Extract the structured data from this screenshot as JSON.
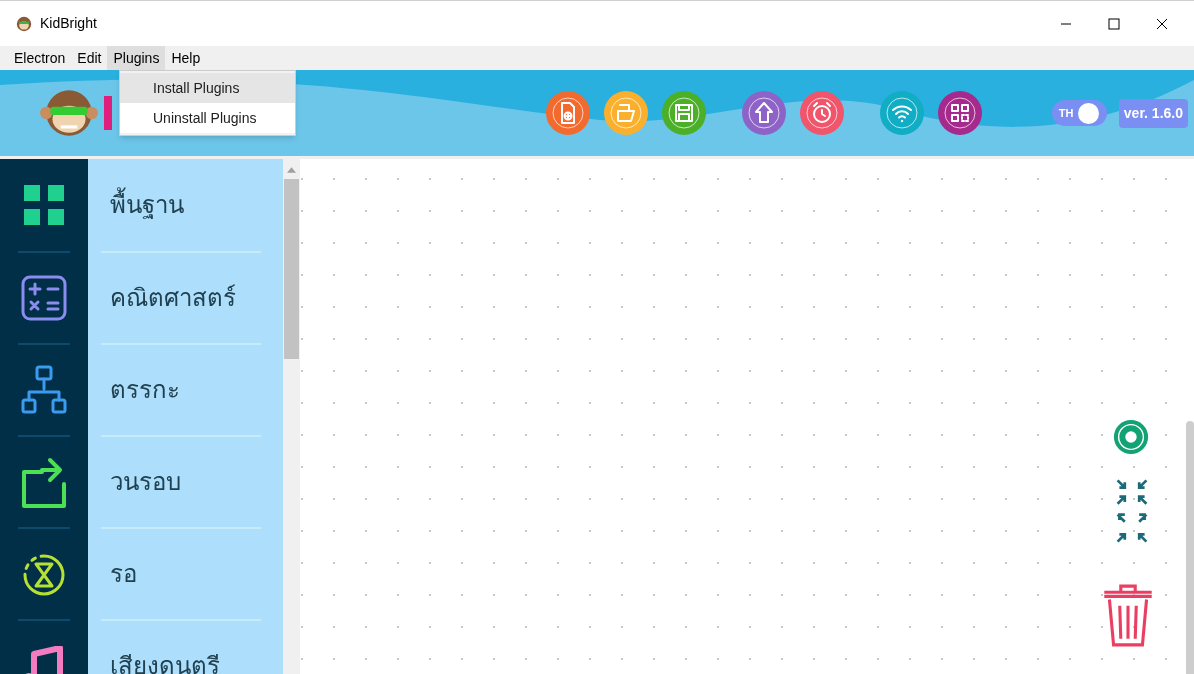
{
  "window": {
    "title": "KidBright"
  },
  "menu": [
    {
      "label": "Electron",
      "selected": false
    },
    {
      "label": "Edit",
      "selected": false
    },
    {
      "label": "Plugins",
      "selected": true
    },
    {
      "label": "Help",
      "selected": false
    }
  ],
  "dropdown": [
    {
      "label": "Install Plugins",
      "selected": true
    },
    {
      "label": "Uninstall Plugins",
      "selected": false
    }
  ],
  "toolbar": [
    {
      "kind": "new",
      "color": "#f26a2d"
    },
    {
      "kind": "open",
      "color": "#fbb02d"
    },
    {
      "kind": "save",
      "color": "#4caf28"
    },
    {
      "kind": "upload",
      "color": "#8e63c7"
    },
    {
      "kind": "alarm",
      "color": "#f0556b"
    },
    {
      "kind": "wifi",
      "color": "#10adc4"
    },
    {
      "kind": "qr",
      "color": "#a62a8e"
    }
  ],
  "language_toggle": {
    "label": "TH",
    "on": true
  },
  "version": "ver. 1.6.0",
  "categories": [
    {
      "kind": "grid",
      "label": "พื้นฐาน",
      "color": "#1fd08e"
    },
    {
      "kind": "calc",
      "label": "คณิตศาสตร์",
      "color": "#8a8cf0"
    },
    {
      "kind": "tree",
      "label": "ตรรกะ",
      "color": "#3a9bf0"
    },
    {
      "kind": "loop",
      "label": "วนรอบ",
      "color": "#4ce054"
    },
    {
      "kind": "wait",
      "label": "รอ",
      "color": "#b6e033"
    },
    {
      "kind": "music",
      "label": "เสียงดนตรี",
      "color": "#f27cc0"
    }
  ]
}
